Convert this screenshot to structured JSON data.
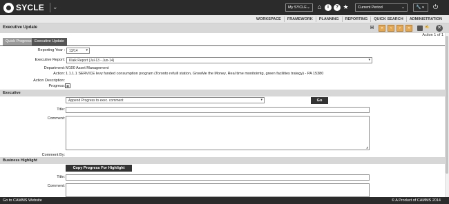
{
  "header": {
    "logo_text": "SYCLE",
    "my_sycle_label": "My SYCLE",
    "period_label": "Current Period",
    "icons": [
      "home-icon",
      "info-icon",
      "help-icon",
      "star-icon",
      "wrench-icon",
      "power-icon"
    ]
  },
  "nav": {
    "items": [
      "WORKSPACE",
      "FRAMEWORK",
      "PLANNING",
      "REPORTING",
      "QUICK SEARCH",
      "ADMINISTRATION"
    ]
  },
  "titlebar": {
    "title": "Executive Update",
    "h_label": "H",
    "action_of": "Action 1 of 1"
  },
  "tabs": {
    "quick": "Quick Progress",
    "exec": "Executive Update"
  },
  "form": {
    "reporting_year_label": "Reporting Year :",
    "reporting_year_value": "13/14",
    "executive_report_label": "Executive Report:",
    "executive_report_value": "Klaik Report (Jul-13 - Jun-14)",
    "department_label": "Department:",
    "department_value": "M100 Asset Management",
    "action_label": "Action:",
    "action_value": "1.1.1.1 SERVICE levy funded consumption program (Toronto refuill station, GrowMe the Money, Real time monitoirntg, green facilities trategy) - PA 15380",
    "action_desc_label": "Action Description:",
    "progress_label": "Progress:"
  },
  "executive": {
    "section_title": "Executive",
    "dropdown_value": "Append Progress to exec. comment",
    "go_label": "Go",
    "title_label": "Title:",
    "comment_label": "Comment:",
    "comment_by_label": "Comment By:"
  },
  "business": {
    "section_title": "Business Highlight",
    "copy_label": "Copy Progress For Highlight",
    "title_label": "Title:",
    "comment_label": "Comment:"
  },
  "footer": {
    "left": "Go to CAMMS Website",
    "right": "© A Product of CAMMS 2014"
  },
  "colors": {
    "topbar": "#2b2b2b",
    "accent_orange": "#e3a853",
    "section_gray": "#d7d7d7"
  }
}
